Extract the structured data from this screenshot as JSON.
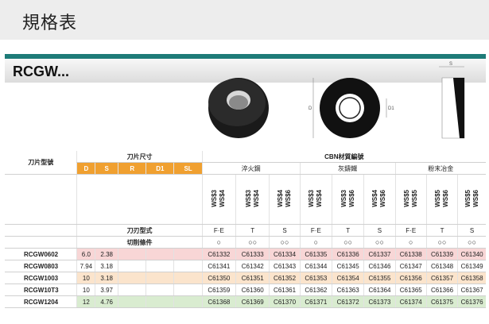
{
  "page": {
    "title": "規格表",
    "series": "RCGW..."
  },
  "diagram": {
    "dim_top": "S",
    "dim_side": "D",
    "dim_hole": "D1"
  },
  "table": {
    "col_group": "刀片尺寸",
    "model_header": "刀片型號",
    "cbn_header": "CBN材質編號",
    "dims": [
      "D",
      "S",
      "R",
      "D1",
      "SL"
    ],
    "materials": [
      "淬火鋼",
      "灰鑄鐵",
      "粉末冶金"
    ],
    "grades": [
      "WS$3",
      "WS$4",
      "WS$3",
      "WS$4",
      "WS$6",
      "WS$3",
      "WS$4",
      "WS$6",
      "WS$5",
      "WS$5",
      "WS$6"
    ],
    "edge_label": "刀刃型式",
    "cond_label": "切削條件",
    "edge_types": [
      "F·E",
      "T",
      "S",
      "F·E",
      "T",
      "S",
      "F·E",
      "T",
      "S"
    ],
    "cond_symbols": [
      "○",
      "○○",
      "○○",
      "○",
      "○○",
      "○○",
      "○",
      "○○",
      "○○"
    ],
    "rows": [
      {
        "model": "RCGW0602",
        "D": "6.0",
        "S": "2.38",
        "codes": [
          "C61332",
          "C61333",
          "C61334",
          "C61335",
          "C61336",
          "C61337",
          "C61338",
          "C61339",
          "C61340"
        ]
      },
      {
        "model": "RCGW0803",
        "D": "7.94",
        "S": "3.18",
        "codes": [
          "C61341",
          "C61342",
          "C61343",
          "C61344",
          "C61345",
          "C61346",
          "C61347",
          "C61348",
          "C61349"
        ]
      },
      {
        "model": "RCGW1003",
        "D": "10",
        "S": "3.18",
        "codes": [
          "C61350",
          "C61351",
          "C61352",
          "C61353",
          "C61354",
          "C61355",
          "C61356",
          "C61357",
          "C61358"
        ]
      },
      {
        "model": "RCGW10T3",
        "D": "10",
        "S": "3.97",
        "codes": [
          "C61359",
          "C61360",
          "C61361",
          "C61362",
          "C61363",
          "C61364",
          "C61365",
          "C61366",
          "C61367"
        ]
      },
      {
        "model": "RCGW1204",
        "D": "12",
        "S": "4.76",
        "codes": [
          "C61368",
          "C61369",
          "C61370",
          "C61371",
          "C61372",
          "C61373",
          "C61374",
          "C61375",
          "C61376"
        ]
      }
    ]
  }
}
